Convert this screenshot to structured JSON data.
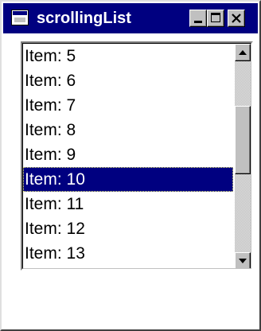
{
  "window": {
    "title": "scrollingList"
  },
  "titlebar_buttons": {
    "minimize": "minimize-icon",
    "maximize": "maximize-icon",
    "close": "close-icon"
  },
  "list": {
    "items": [
      {
        "label": "Item: 5",
        "selected": false
      },
      {
        "label": "Item: 6",
        "selected": false
      },
      {
        "label": "Item: 7",
        "selected": false
      },
      {
        "label": "Item: 8",
        "selected": false
      },
      {
        "label": "Item: 9",
        "selected": false
      },
      {
        "label": "Item: 10",
        "selected": true
      },
      {
        "label": "Item: 11",
        "selected": false
      },
      {
        "label": "Item: 12",
        "selected": false
      },
      {
        "label": "Item: 13",
        "selected": false
      }
    ],
    "selected_label": "Item: 10"
  },
  "colors": {
    "titlebar": "#000080",
    "selection": "#000080",
    "face": "#c0c0c0"
  }
}
